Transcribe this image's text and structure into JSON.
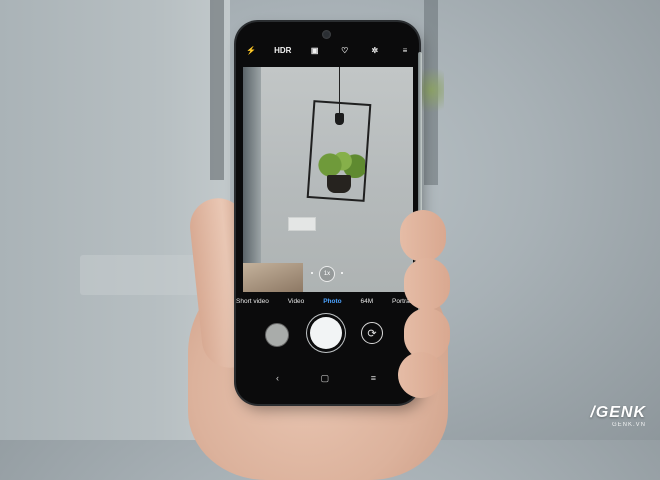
{
  "camera": {
    "top_icons": [
      {
        "icon": "flash-auto-icon",
        "glyph": "⚡"
      },
      {
        "icon": "hdr-label",
        "label": "HDR"
      },
      {
        "icon": "ai-icon",
        "glyph": "▣"
      },
      {
        "icon": "beauty-icon",
        "glyph": "♡"
      },
      {
        "icon": "filters-icon",
        "glyph": "✲"
      },
      {
        "icon": "menu-icon",
        "glyph": "≡"
      }
    ],
    "zoom_label": "1x",
    "modes": [
      "Short video",
      "Video",
      "Photo",
      "64M",
      "Portrait"
    ],
    "active_mode": "Photo",
    "flip_glyph": "⟳"
  },
  "navigation": {
    "back_glyph": "‹",
    "home_glyph": "▢",
    "recents_glyph": "≡"
  },
  "watermark": {
    "brand": "/GENK",
    "site": "GENK.VN"
  }
}
